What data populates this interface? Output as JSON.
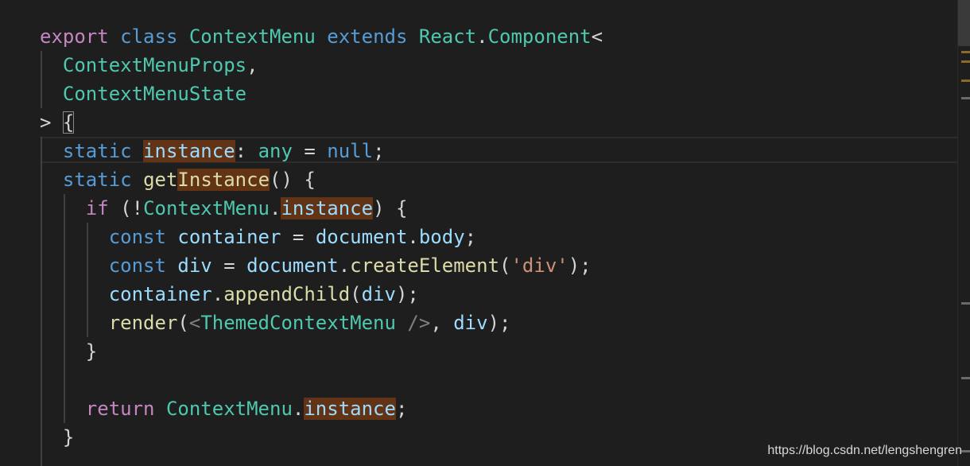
{
  "colors": {
    "background": "#1e1e1e",
    "keyword": "#c586c0",
    "storage": "#569cd6",
    "type": "#4ec9b0",
    "variable": "#9cdcfe",
    "function": "#dcdcaa",
    "string": "#ce9178",
    "punctuation": "#d4d4d4",
    "highlight": "#623315"
  },
  "code": {
    "lines": [
      {
        "name": "line-class-declaration",
        "tokens": [
          {
            "t": "export",
            "c": "kw"
          },
          {
            "t": " ",
            "c": "pu"
          },
          {
            "t": "class",
            "c": "st"
          },
          {
            "t": " ",
            "c": "pu"
          },
          {
            "t": "ContextMenu",
            "c": "ty"
          },
          {
            "t": " ",
            "c": "pu"
          },
          {
            "t": "extends",
            "c": "st"
          },
          {
            "t": " ",
            "c": "pu"
          },
          {
            "t": "React",
            "c": "ty"
          },
          {
            "t": ".",
            "c": "pu"
          },
          {
            "t": "Component",
            "c": "ty"
          },
          {
            "t": "<",
            "c": "pu"
          }
        ]
      },
      {
        "name": "line-props-type",
        "tokens": [
          {
            "t": "  ",
            "c": "pu"
          },
          {
            "t": "ContextMenuProps",
            "c": "ty"
          },
          {
            "t": ",",
            "c": "pu"
          }
        ]
      },
      {
        "name": "line-state-type",
        "tokens": [
          {
            "t": "  ",
            "c": "pu"
          },
          {
            "t": "ContextMenuState",
            "c": "ty"
          }
        ]
      },
      {
        "name": "line-class-open",
        "tokens": [
          {
            "t": "> ",
            "c": "pu"
          },
          {
            "t": "{",
            "c": "pu",
            "box": true
          }
        ]
      },
      {
        "name": "line-static-instance",
        "tokens": [
          {
            "t": "  ",
            "c": "pu"
          },
          {
            "t": "static",
            "c": "st"
          },
          {
            "t": " ",
            "c": "pu"
          },
          {
            "t": "instance",
            "c": "va",
            "hl": true
          },
          {
            "t": ": ",
            "c": "pu"
          },
          {
            "t": "any",
            "c": "ty"
          },
          {
            "t": " = ",
            "c": "pu"
          },
          {
            "t": "null",
            "c": "st"
          },
          {
            "t": ";",
            "c": "pu"
          }
        ]
      },
      {
        "name": "line-get-instance",
        "tokens": [
          {
            "t": "  ",
            "c": "pu"
          },
          {
            "t": "static",
            "c": "st"
          },
          {
            "t": " ",
            "c": "pu"
          },
          {
            "t": "get",
            "c": "fn"
          },
          {
            "t": "Instance",
            "c": "fn",
            "hl": true
          },
          {
            "t": "() {",
            "c": "pu"
          }
        ]
      },
      {
        "name": "line-if-check",
        "tokens": [
          {
            "t": "    ",
            "c": "pu"
          },
          {
            "t": "if",
            "c": "kw"
          },
          {
            "t": " (!",
            "c": "pu"
          },
          {
            "t": "ContextMenu",
            "c": "ty"
          },
          {
            "t": ".",
            "c": "pu"
          },
          {
            "t": "instance",
            "c": "va",
            "hl": true
          },
          {
            "t": ") {",
            "c": "pu"
          }
        ]
      },
      {
        "name": "line-const-container",
        "tokens": [
          {
            "t": "      ",
            "c": "pu"
          },
          {
            "t": "const",
            "c": "st"
          },
          {
            "t": " ",
            "c": "pu"
          },
          {
            "t": "container",
            "c": "va"
          },
          {
            "t": " = ",
            "c": "pu"
          },
          {
            "t": "document",
            "c": "va"
          },
          {
            "t": ".",
            "c": "pu"
          },
          {
            "t": "body",
            "c": "va"
          },
          {
            "t": ";",
            "c": "pu"
          }
        ]
      },
      {
        "name": "line-const-div",
        "tokens": [
          {
            "t": "      ",
            "c": "pu"
          },
          {
            "t": "const",
            "c": "st"
          },
          {
            "t": " ",
            "c": "pu"
          },
          {
            "t": "div",
            "c": "va"
          },
          {
            "t": " = ",
            "c": "pu"
          },
          {
            "t": "document",
            "c": "va"
          },
          {
            "t": ".",
            "c": "pu"
          },
          {
            "t": "createElement",
            "c": "fn"
          },
          {
            "t": "(",
            "c": "pu"
          },
          {
            "t": "'div'",
            "c": "str"
          },
          {
            "t": ");",
            "c": "pu"
          }
        ]
      },
      {
        "name": "line-append-child",
        "tokens": [
          {
            "t": "      ",
            "c": "pu"
          },
          {
            "t": "container",
            "c": "va"
          },
          {
            "t": ".",
            "c": "pu"
          },
          {
            "t": "appendChild",
            "c": "fn"
          },
          {
            "t": "(",
            "c": "pu"
          },
          {
            "t": "div",
            "c": "va"
          },
          {
            "t": ");",
            "c": "pu"
          }
        ]
      },
      {
        "name": "line-render",
        "tokens": [
          {
            "t": "      ",
            "c": "pu"
          },
          {
            "t": "render",
            "c": "fn"
          },
          {
            "t": "(",
            "c": "pu"
          },
          {
            "t": "<",
            "c": "tagb"
          },
          {
            "t": "ThemedContextMenu",
            "c": "ty"
          },
          {
            "t": " ",
            "c": "pu"
          },
          {
            "t": "/>",
            "c": "tagb"
          },
          {
            "t": ", ",
            "c": "pu"
          },
          {
            "t": "div",
            "c": "va"
          },
          {
            "t": ");",
            "c": "pu"
          }
        ]
      },
      {
        "name": "line-if-close",
        "tokens": [
          {
            "t": "    ",
            "c": "pu"
          },
          {
            "t": "}",
            "c": "pu"
          }
        ]
      },
      {
        "name": "line-blank",
        "tokens": []
      },
      {
        "name": "line-return",
        "tokens": [
          {
            "t": "    ",
            "c": "pu"
          },
          {
            "t": "return",
            "c": "kw"
          },
          {
            "t": " ",
            "c": "pu"
          },
          {
            "t": "ContextMenu",
            "c": "ty"
          },
          {
            "t": ".",
            "c": "pu"
          },
          {
            "t": "instance",
            "c": "va",
            "hl": true
          },
          {
            "t": ";",
            "c": "pu"
          }
        ]
      },
      {
        "name": "line-method-close",
        "tokens": [
          {
            "t": "  ",
            "c": "pu"
          },
          {
            "t": "}",
            "c": "pu"
          }
        ]
      }
    ]
  },
  "watermark": "https://blog.csdn.net/lengshengren"
}
